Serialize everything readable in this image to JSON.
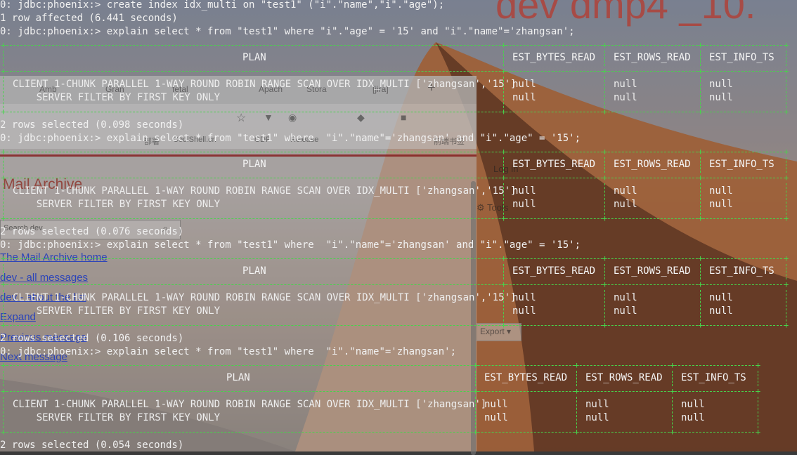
{
  "wallpaper": {
    "title": "dev dmp4 _10."
  },
  "browser": {
    "tabs": [
      "Amb",
      "Gran",
      "fetal",
      "Apach",
      "Stora",
      "[jira]"
    ],
    "bookmarks": [
      "部署",
      "CoolShell.cn",
      "CDP",
      "Release",
      "前端书签",
      "其他书签"
    ],
    "login": "Log in",
    "tools": "Tools",
    "page_title": "Mail Archive",
    "search_placeholder": "Search dev",
    "links": [
      "The Mail Archive home",
      "dev - all messages",
      "dev - about the list",
      "Expand",
      "Previous message",
      "Next message"
    ],
    "export_label": "Export ▾",
    "colors": {
      "link": "#2c4ad8",
      "accent": "#962014"
    }
  },
  "terminal": {
    "colors": {
      "text": "#f1f1f1",
      "border": "#47d44b"
    },
    "lines": [
      {
        "id": "cmd1",
        "text": "0: jdbc:phoenix:> create index idx_multi on \"test1\" (\"i\".\"name\",\"i\".\"age\");"
      },
      {
        "id": "res1",
        "text": "1 row affected (6.441 seconds)"
      },
      {
        "id": "cmd2",
        "text": "0: jdbc:phoenix:> explain select * from \"test1\" where \"i\".\"age\" = '15' and \"i\".\"name\"='zhangsan';"
      },
      {
        "id": "res2",
        "text": "2 rows selected (0.098 seconds)"
      },
      {
        "id": "cmd3",
        "text": "0: jdbc:phoenix:> explain select * from \"test1\" where  \"i\".\"name\"='zhangsan' and \"i\".\"age\" = '15';"
      },
      {
        "id": "res3",
        "text": "2 rows selected (0.076 seconds)"
      },
      {
        "id": "cmd4",
        "text": "0: jdbc:phoenix:> explain select * from \"test1\" where  \"i\".\"name\"='zhangsan' and \"i\".\"age\" = '15';"
      },
      {
        "id": "res4",
        "text": "2 rows selected (0.106 seconds)"
      },
      {
        "id": "cmd5",
        "text": "0: jdbc:phoenix:> explain select * from \"test1\" where  \"i\".\"name\"='zhangsan';"
      },
      {
        "id": "res5",
        "text": "2 rows selected (0.054 seconds)"
      }
    ],
    "columns": [
      "PLAN",
      "EST_BYTES_READ",
      "EST_ROWS_READ",
      "EST_INFO_TS"
    ],
    "tables": [
      {
        "rows": [
          [
            "CLIENT 1-CHUNK PARALLEL 1-WAY ROUND ROBIN RANGE SCAN OVER IDX_MULTI ['zhangsan','15']",
            "null",
            "null",
            "null"
          ],
          [
            "    SERVER FILTER BY FIRST KEY ONLY",
            "null",
            "null",
            "null"
          ]
        ]
      },
      {
        "rows": [
          [
            "CLIENT 1-CHUNK PARALLEL 1-WAY ROUND ROBIN RANGE SCAN OVER IDX_MULTI ['zhangsan','15']",
            "null",
            "null",
            "null"
          ],
          [
            "    SERVER FILTER BY FIRST KEY ONLY",
            "null",
            "null",
            "null"
          ]
        ]
      },
      {
        "rows": [
          [
            "CLIENT 1-CHUNK PARALLEL 1-WAY ROUND ROBIN RANGE SCAN OVER IDX_MULTI ['zhangsan','15']",
            "null",
            "null",
            "null"
          ],
          [
            "    SERVER FILTER BY FIRST KEY ONLY",
            "null",
            "null",
            "null"
          ]
        ]
      },
      {
        "rows": [
          [
            "CLIENT 1-CHUNK PARALLEL 1-WAY ROUND ROBIN RANGE SCAN OVER IDX_MULTI ['zhangsan']",
            "null",
            "null",
            "null"
          ],
          [
            "    SERVER FILTER BY FIRST KEY ONLY",
            "null",
            "null",
            "null"
          ]
        ]
      }
    ]
  }
}
